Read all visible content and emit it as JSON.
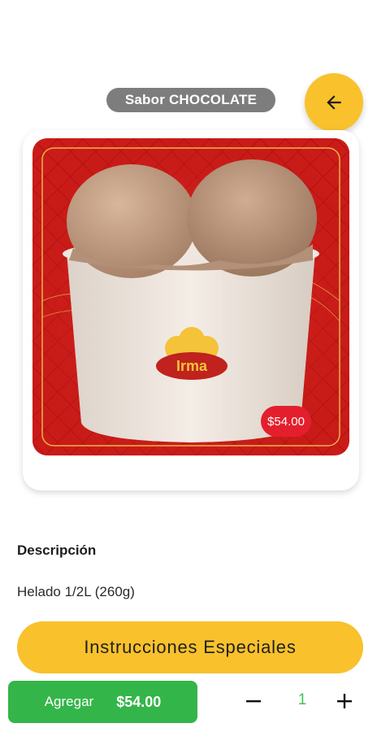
{
  "header": {
    "flavor_label": "Sabor CHOCOLATE"
  },
  "product": {
    "image_icon": "ice-cream-cup-image",
    "brand_logo_text": "Irma",
    "price_badge": "$54.00"
  },
  "description": {
    "title": "Descripción",
    "text": "Helado 1/2L (260g)"
  },
  "special_instructions": {
    "label": "Instrucciones Especiales"
  },
  "cart": {
    "add_label": "Agregar",
    "add_price": "$54.00",
    "quantity": "1",
    "minus_icon": "minus-icon",
    "plus_icon": "plus-icon"
  },
  "colors": {
    "accent_yellow": "#f9c12c",
    "pill_gray": "#7d7d7d",
    "add_green": "#34b54a",
    "price_red": "#e41f2d"
  }
}
